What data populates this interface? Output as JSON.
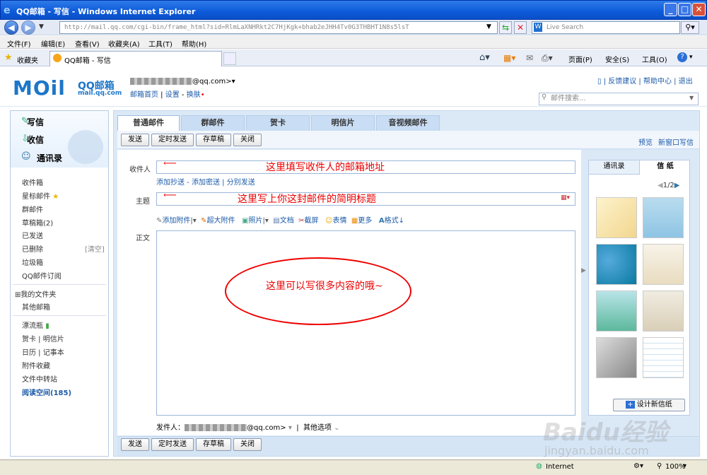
{
  "window": {
    "title": "QQ邮箱 - 写信 - Windows Internet Explorer"
  },
  "browser": {
    "address": "http://mail.qq.com/cgi-bin/frame_html?sid=RlmLaXNHRkt2C7HjKgk+bhab2eJHH4Tv0G3THBHT1N8s5lsT",
    "search_placeholder": "Live Search",
    "menu": [
      "文件(F)",
      "编辑(E)",
      "查看(V)",
      "收藏夹(A)",
      "工具(T)",
      "帮助(H)"
    ],
    "favorites_label": "收藏夹",
    "tab_label": "QQ邮箱 - 写信",
    "toolbar": [
      "页面(P)",
      "安全(S)",
      "工具(O)"
    ],
    "status": {
      "zone": "Internet",
      "zoom": "100%"
    }
  },
  "mail": {
    "logo": "MOil",
    "logo_sub": "QQ邮箱",
    "logo_url": "mail.qq.com",
    "account_suffix": "@qq.com>",
    "links": [
      "邮箱首页",
      "设置",
      "换肤"
    ],
    "top_right": [
      "反馈建议",
      "帮助中心",
      "退出"
    ],
    "search_placeholder": "邮件搜索..."
  },
  "sidebar": {
    "big": [
      "写信",
      "收信",
      "通讯录"
    ],
    "items": [
      "收件箱",
      "星标邮件",
      "群邮件",
      "草稿箱(2)",
      "已发送",
      "已删除",
      "垃圾箱",
      "QQ邮件订阅"
    ],
    "clear_label": "[清空]",
    "folders": [
      "我的文件夹",
      "其他邮箱"
    ],
    "extra": [
      "漂流瓶",
      "贺卡",
      "明信片",
      "日历",
      "记事本",
      "附件收藏",
      "文件中转站",
      "阅读空间(185)"
    ]
  },
  "compose": {
    "tabs": [
      "普通邮件",
      "群邮件",
      "贺卡",
      "明信片",
      "音视频邮件"
    ],
    "buttons": [
      "发送",
      "定时发送",
      "存草稿",
      "关闭"
    ],
    "top_right": [
      "预览",
      "新窗口写信"
    ],
    "to_label": "收件人",
    "to_annotation": "这里填写收件人的邮箱地址",
    "cc_links": [
      "添加抄送",
      "添加密送",
      "分别发送"
    ],
    "subject_label": "主题",
    "subject_annotation": "这里写上你这封邮件的简明标题",
    "attach_tools": [
      "添加附件",
      "超大附件",
      "照片",
      "文档",
      "截屏",
      "表情",
      "更多",
      "格式↓"
    ],
    "body_label": "正文",
    "body_annotation": "这里可以写很多内容的哦~",
    "sender_label": "发件人：",
    "sender_suffix": "@qq.com>",
    "other_options": "其他选项"
  },
  "stationery": {
    "tabs": [
      "通讯录",
      "信 纸"
    ],
    "page": "1/2",
    "design_button": "设计新信纸"
  },
  "watermark": {
    "text": "Baidu经验",
    "url": "jingyan.baidu.com"
  }
}
